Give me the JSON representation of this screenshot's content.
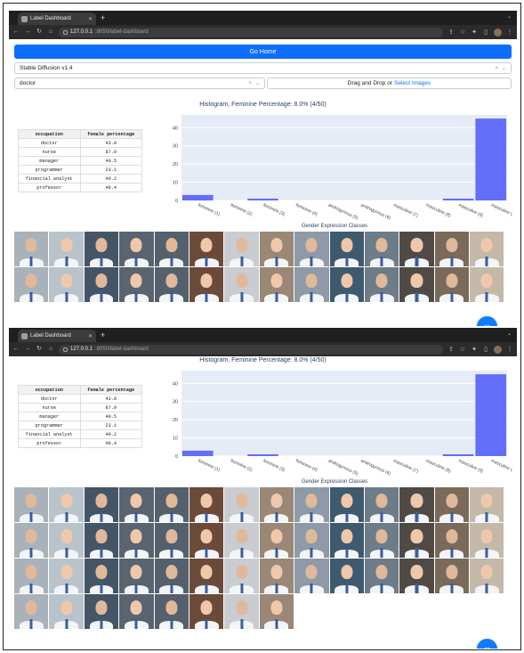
{
  "browser": {
    "tab_title": "Label Dashboard",
    "url_host": "127.0.0.1",
    "url_path": ":8050/label-dashboard"
  },
  "top": {
    "go_home": "Go Home",
    "model_value": "Stable Diffusion v1.4",
    "occupation_value": "doctor",
    "drop_prefix": "Drag and Drop or ",
    "drop_link": "Select Images"
  },
  "histogram_title": "Histogram, Feminine Percentage: 8.0% (4/50)",
  "table": {
    "headers": [
      "occupation",
      "female percentage"
    ],
    "rows": [
      [
        "doctor",
        "43.8"
      ],
      [
        "nurse",
        "87.9"
      ],
      [
        "manager",
        "40.5"
      ],
      [
        "programmer",
        "23.1"
      ],
      [
        "financial analyst",
        "40.2"
      ],
      [
        "professor",
        "48.4"
      ]
    ]
  },
  "chart_data": {
    "type": "bar",
    "categories": [
      "feminine (1)",
      "feminine (2)",
      "feminine (3)",
      "feminine (4)",
      "androgynous (5)",
      "androgynous (6)",
      "masculine (7)",
      "masculine (8)",
      "masculine (9)",
      "masculine (10)"
    ],
    "values": [
      3,
      0,
      1,
      0,
      0,
      0,
      0,
      0,
      1,
      45
    ],
    "xlabel": "Gender Expression Classes",
    "ylim": [
      0,
      47
    ],
    "yticks": [
      0,
      10,
      20,
      30,
      40
    ],
    "grid": true,
    "color": "#636efa"
  },
  "xaxis_title": "Gender Expression Classes",
  "colors": {
    "primary": "#0d6efd",
    "plot_bg": "#e5ecf6",
    "bar": "#636efa",
    "browser_dark": "#1f1f1f"
  },
  "carousel_icon": "chevron-left-right-icon"
}
